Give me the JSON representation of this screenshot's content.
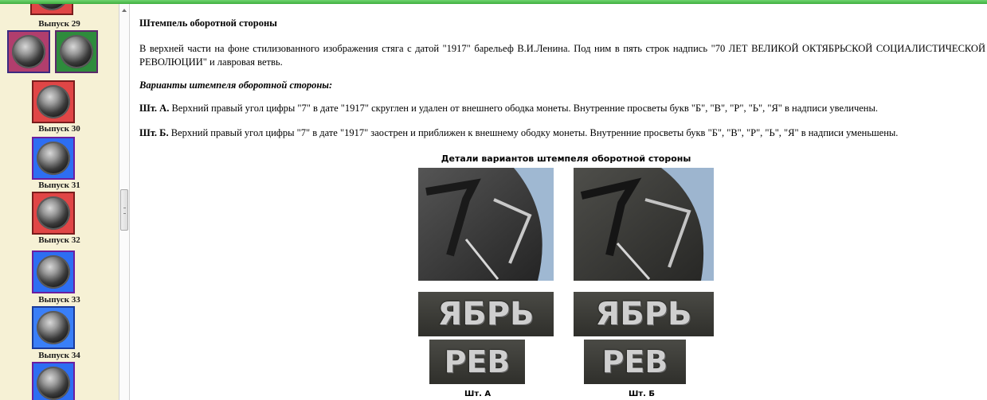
{
  "sidebar": {
    "items": [
      {
        "label": "Выпуск 29"
      },
      {
        "label": "Выпуск 30"
      },
      {
        "label": "Выпуск 31"
      },
      {
        "label": "Выпуск 32"
      },
      {
        "label": "Выпуск 33"
      },
      {
        "label": "Выпуск 34"
      }
    ]
  },
  "content": {
    "heading": "Штемпель оборотной стороны",
    "description": "В верхней части на фоне стилизованного изображения стяга с датой \"1917\" барельеф В.И.Ленина. Под ним в пять строк надпись \"70 ЛЕТ ВЕЛИКОЙ ОКТЯБРЬСКОЙ СОЦИАЛИСТИЧЕСКОЙ РЕВОЛЮЦИИ\" и лавровая ветвь.",
    "variants_title": "Варианты штемпеля оборотной стороны:",
    "variant_a": {
      "label": "Шт. А.",
      "text": " Верхний правый угол цифры \"7\" в дате \"1917\" скруглен и удален от внешнего ободка монеты. Внутренние просветы букв \"Б\", \"В\", \"Р\", \"Ь\", \"Я\" в надписи увеличены."
    },
    "variant_b": {
      "label": "Шт. Б.",
      "text": " Верхний правый угол цифры \"7\" в дате \"1917\" заострен и приближен к внешнему ободку монеты. Внутренние просветы букв \"Б\", \"В\", \"Р\", \"Ь\", \"Я\" в надписи уменьшены."
    }
  },
  "detail_image": {
    "title": "Детали вариантов штемпеля оборотной стороны",
    "word_top": "ЯБРЬ",
    "word_bottom": "РЕВ",
    "label_a": "Шт. А",
    "label_b": "Шт. Б"
  }
}
